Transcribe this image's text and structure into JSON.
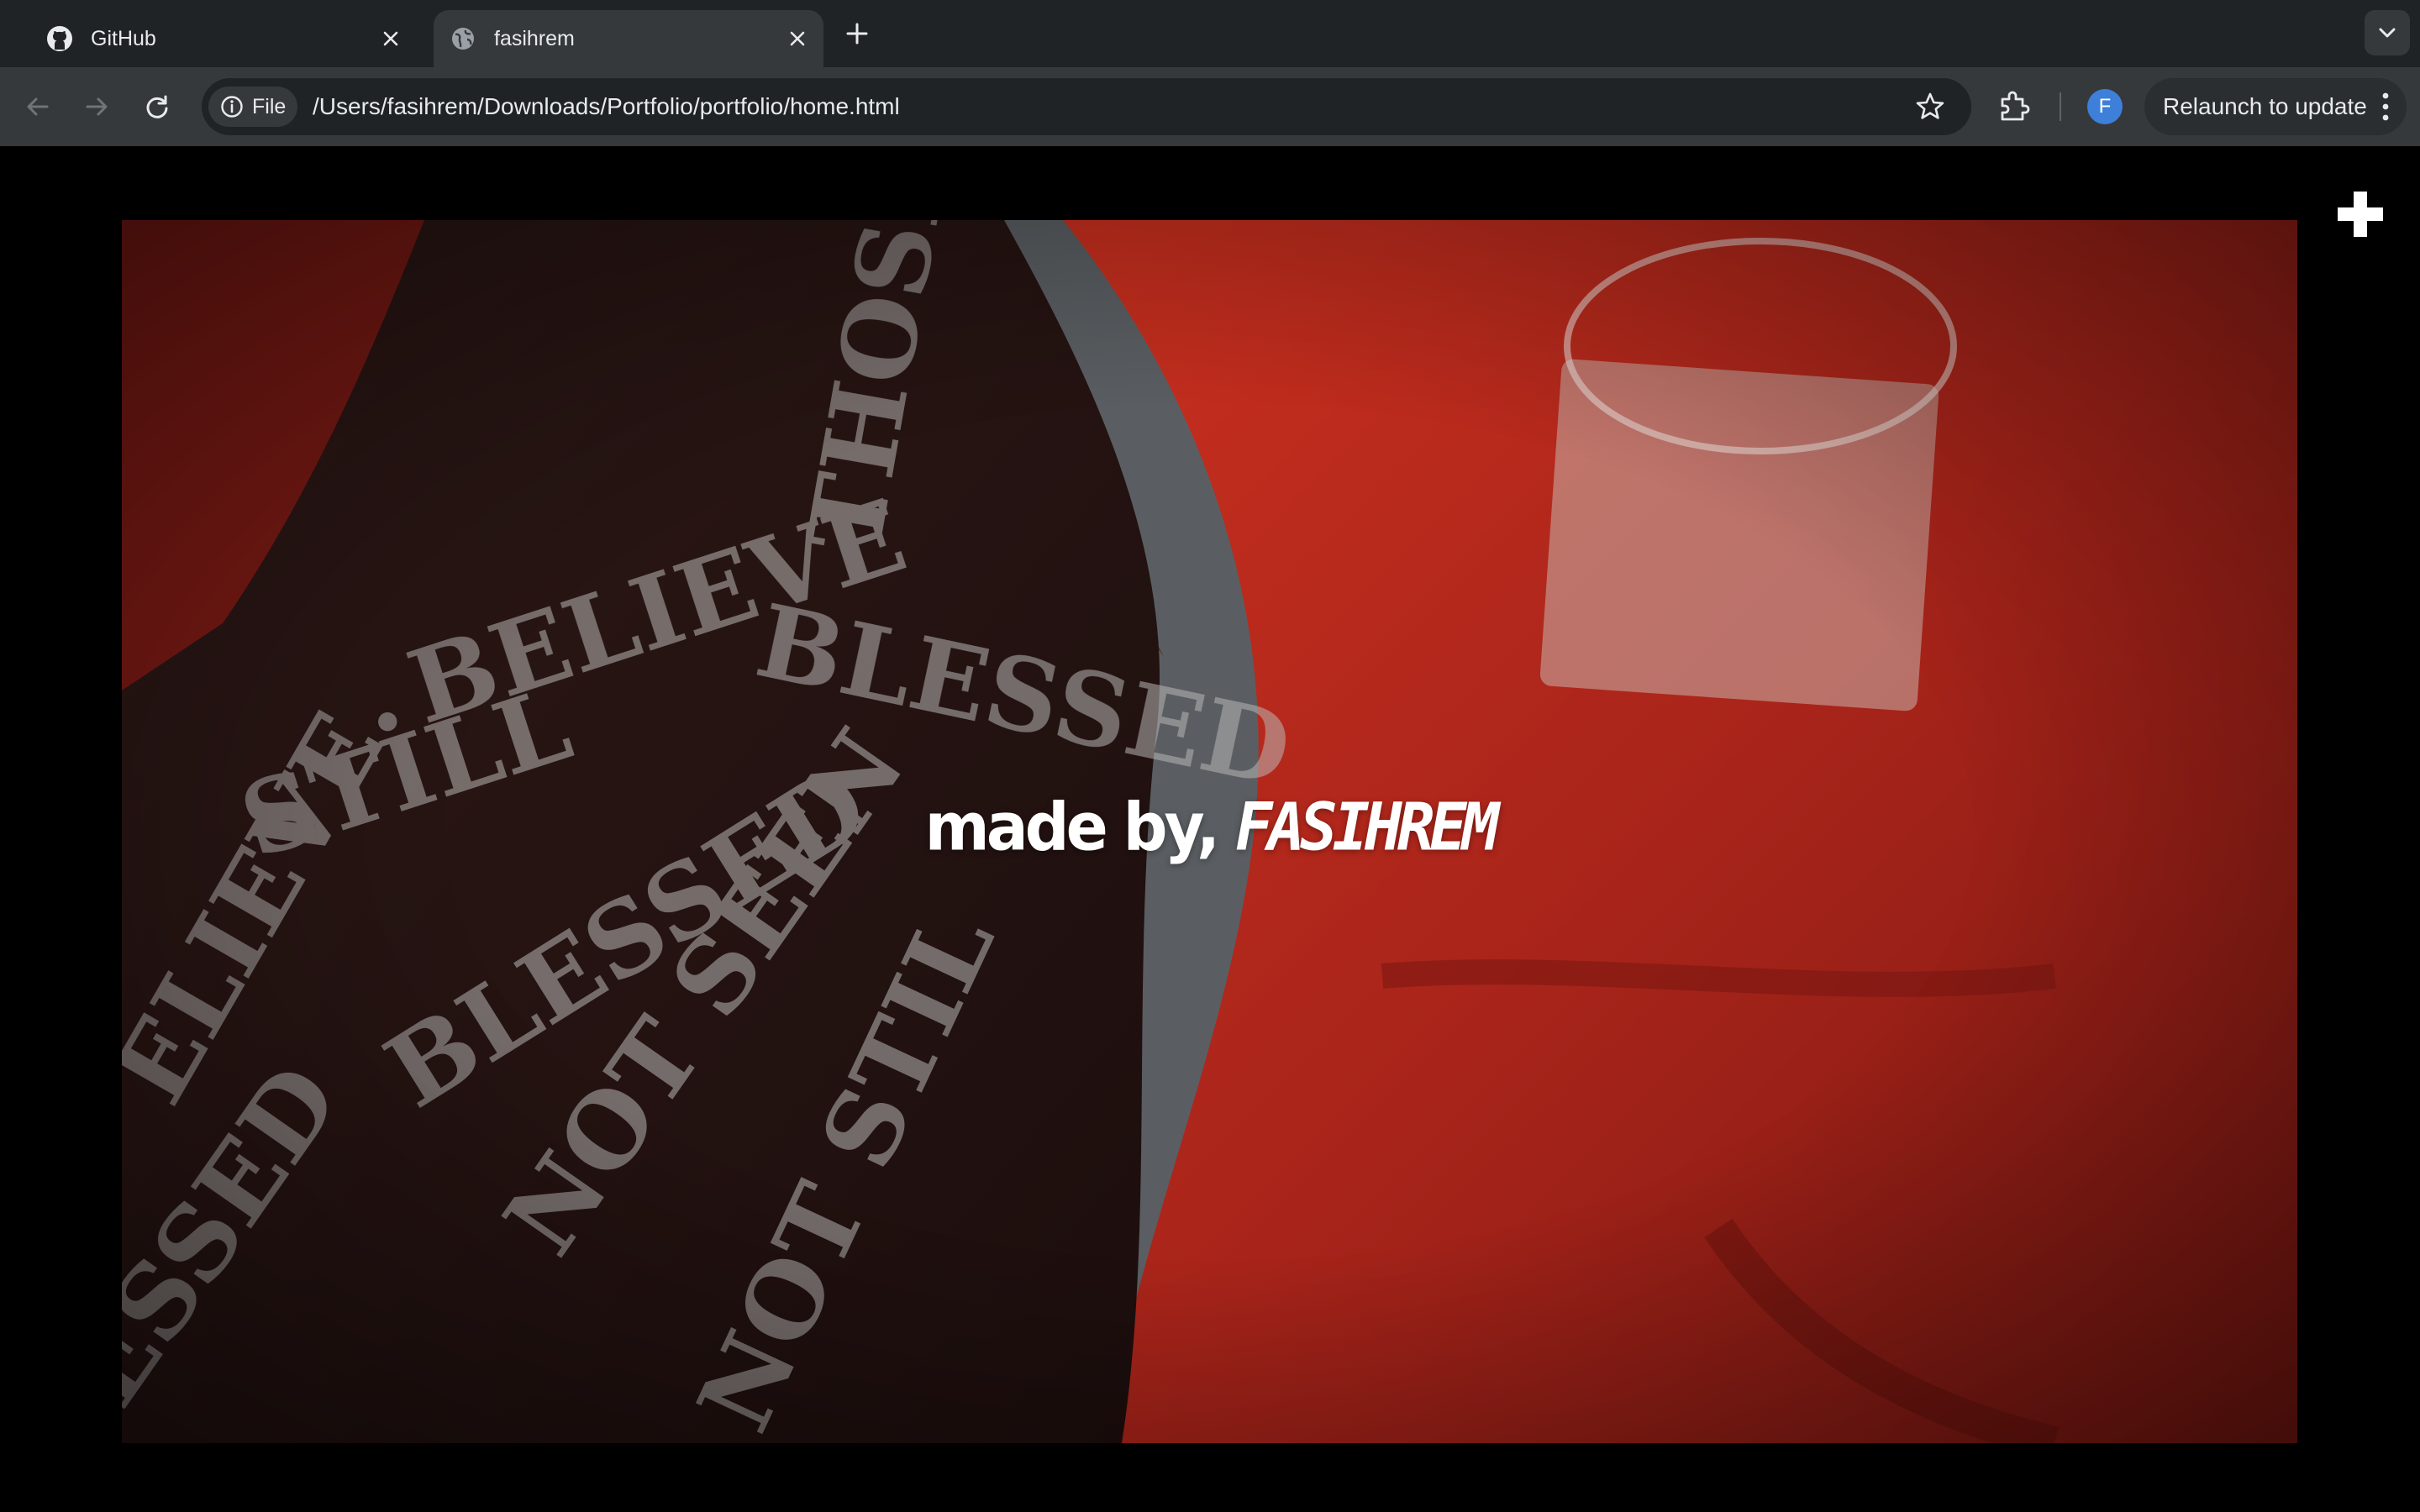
{
  "browser": {
    "tabs": [
      {
        "title": "GitHub",
        "icon": "github-icon",
        "active": false
      },
      {
        "title": "fasihrem",
        "icon": "globe-icon",
        "active": true
      }
    ],
    "omnibox": {
      "chip_label": "File",
      "url": "/Users/fasihrem/Downloads/Portfolio/portfolio/home.html"
    },
    "profile_initial": "F",
    "relaunch_label": "Relaunch to update"
  },
  "page": {
    "caption_prefix": "made by, ",
    "caption_logo": "FASIHREM",
    "colors": {
      "background": "#000000",
      "jacket_red": "#b3251a",
      "jacket_dark": "#2a1512"
    }
  }
}
